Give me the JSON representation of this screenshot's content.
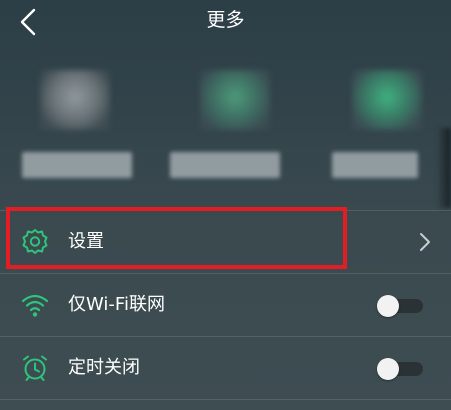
{
  "header": {
    "title": "更多",
    "back_icon": "chevron-left-icon"
  },
  "menu": {
    "items": [
      {
        "label": "设置",
        "icon": "gear-icon",
        "control": "chevron"
      },
      {
        "label": "仅Wi-Fi联网",
        "icon": "wifi-icon",
        "control": "toggle",
        "state": "off"
      },
      {
        "label": "定时关闭",
        "icon": "alarm-clock-icon",
        "control": "toggle",
        "state": "off"
      }
    ]
  },
  "colors": {
    "accent": "#2fc47a",
    "highlight": "#e21d24"
  }
}
